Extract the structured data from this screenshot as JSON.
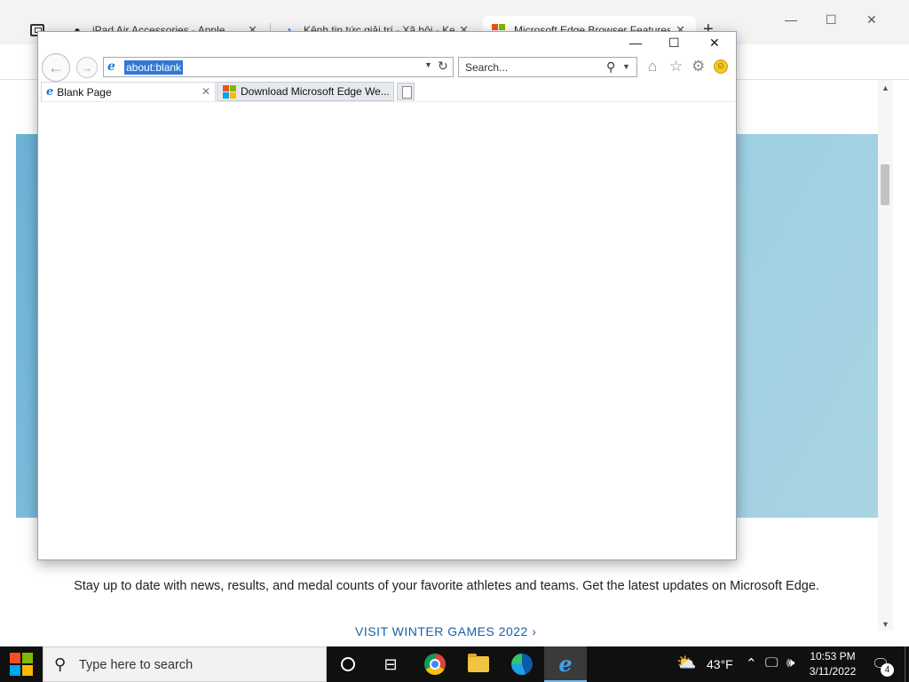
{
  "edge": {
    "tabs": [
      {
        "title": "iPad Air Accessories - Apple",
        "favicon": "apple-icon",
        "active": false
      },
      {
        "title": "Kênh tin tức giải trí - Xã hội - Ke",
        "favicon": "loading-spinner-icon",
        "active": false
      },
      {
        "title": "Microsoft Edge Browser Features",
        "favicon": "microsoft-logo-icon",
        "active": true
      }
    ],
    "new_tab_symbol": "+",
    "window_controls": {
      "minimize": "—",
      "maximize": "☐",
      "close": "✕"
    },
    "toolbar_icons": [
      "favorites-icon",
      "collections-icon",
      "profile-icon",
      "more-icon"
    ],
    "page": {
      "promo_text": "Stay up to date with news, results, and medal counts of your favorite athletes and teams. Get the latest updates on Microsoft Edge.",
      "promo_link": "VISIT WINTER GAMES 2022 ›",
      "hero_color": "#8bc3df"
    }
  },
  "ie": {
    "window_controls": {
      "minimize": "—",
      "maximize": "☐",
      "close": "✕"
    },
    "address": "about:blank",
    "search_placeholder": "Search...",
    "tabs": [
      {
        "title": "Blank Page",
        "favicon": "ie-logo-icon",
        "active": true
      },
      {
        "title": "Download Microsoft Edge We...",
        "favicon": "microsoft-logo-icon",
        "active": false
      }
    ],
    "toolbar_icons": [
      "home-icon",
      "favorites-star-icon",
      "settings-gear-icon",
      "feedback-smiley-icon"
    ]
  },
  "taskbar": {
    "search_placeholder": "Type here to search",
    "apps": [
      "cortana-icon",
      "task-view-icon",
      "chrome-icon",
      "file-explorer-icon",
      "edge-icon",
      "internet-explorer-icon"
    ],
    "weather_temp": "43°F",
    "time": "10:53 PM",
    "date": "3/11/2022",
    "notification_count": "4"
  }
}
